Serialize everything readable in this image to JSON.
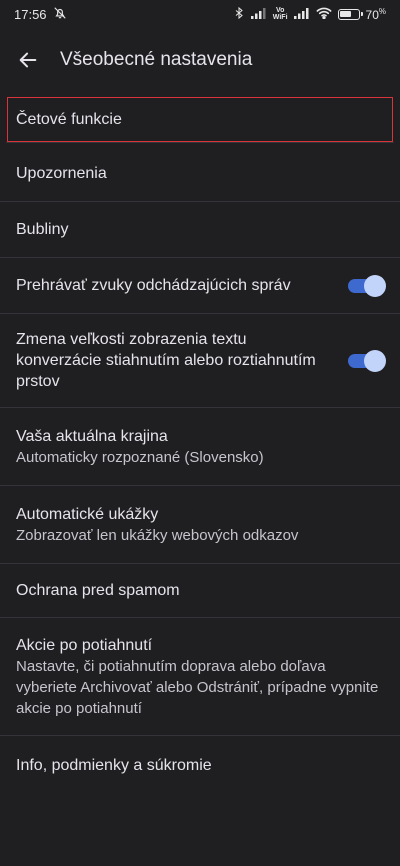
{
  "status_bar": {
    "time": "17:56",
    "vowifi_top": "Vo",
    "vowifi_bottom": "WiFi",
    "battery_percent": "70",
    "battery_unit": "%",
    "battery_level": 0.7,
    "icons": [
      "mute-notifications-icon",
      "bluetooth-icon",
      "cell-signal-icon",
      "cell-signal-icon",
      "wifi-icon",
      "battery-icon"
    ]
  },
  "app_bar": {
    "back_icon": "arrow-left-icon",
    "title": "Všeobecné nastavenia"
  },
  "settings": [
    {
      "id": "cetove-funkcie",
      "title": "Četové funkcie",
      "highlighted": true
    },
    {
      "id": "upozornenia",
      "title": "Upozornenia"
    },
    {
      "id": "bubliny",
      "title": "Bubliny"
    },
    {
      "id": "prehravat-zvuky",
      "title": "Prehrávať zvuky odchádzajúcich správ",
      "toggle": true,
      "toggle_on": true
    },
    {
      "id": "zmena-velkosti",
      "title": "Zmena veľkosti zobrazenia textu konverzácie stiahnutím alebo roztiahnutím prstov",
      "toggle": true,
      "toggle_on": true
    },
    {
      "id": "aktualna-krajina",
      "title": "Vaša aktuálna krajina",
      "subtitle": "Automaticky rozpoznané (Slovensko)"
    },
    {
      "id": "automaticke-ukazky",
      "title": "Automatické ukážky",
      "subtitle": "Zobrazovať len ukážky webových odkazov"
    },
    {
      "id": "ochrana-spam",
      "title": "Ochrana pred spamom"
    },
    {
      "id": "akcie-potiahnuti",
      "title": "Akcie po potiahnutí",
      "subtitle": "Nastavte, či potiahnutím doprava alebo doľava vyberiete Archivovať alebo Odstrániť, prípadne vypnite akcie po potiahnutí"
    },
    {
      "id": "info-podmienky",
      "title": "Info, podmienky a súkromie"
    }
  ],
  "colors": {
    "background": "#1f1f22",
    "toggle_track": "#3e6ad0",
    "toggle_knob": "#c3d4fb",
    "highlight_border": "#d8343b",
    "divider": "#34343a"
  }
}
